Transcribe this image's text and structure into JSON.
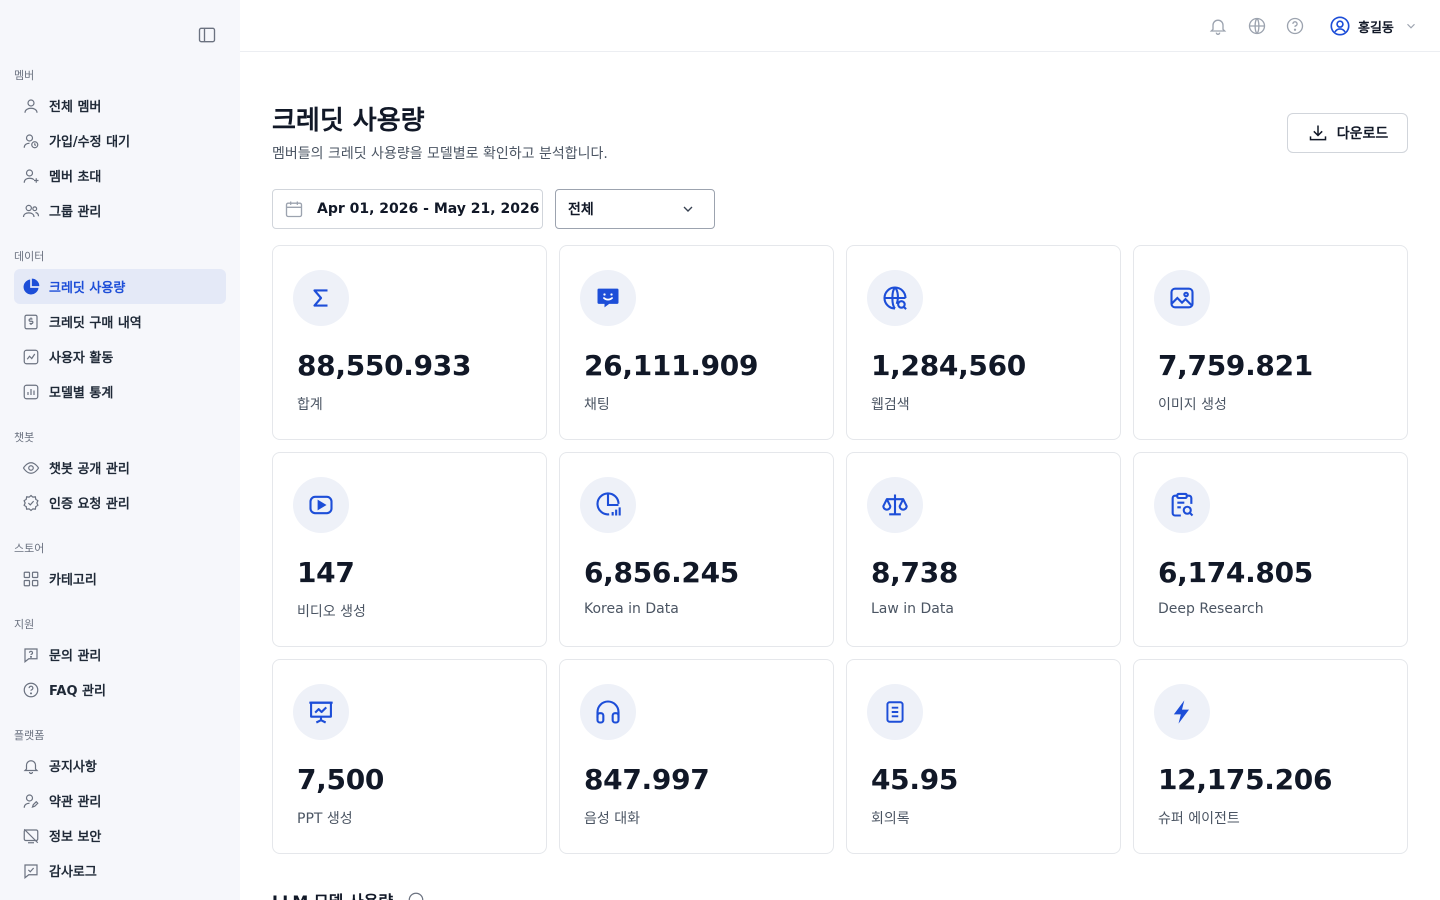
{
  "sidebar": {
    "toggle_icon": "sidebar-toggle-icon",
    "sections": [
      {
        "label": "멤버",
        "items": [
          {
            "label": "전체 멤버",
            "icon": "user-icon"
          },
          {
            "label": "가입/수정 대기",
            "icon": "user-clock-icon"
          },
          {
            "label": "멤버 초대",
            "icon": "user-plus-icon"
          },
          {
            "label": "그룹 관리",
            "icon": "users-icon"
          }
        ]
      },
      {
        "label": "데이터",
        "items": [
          {
            "label": "크레딧 사용량",
            "icon": "pie-chart-icon",
            "active": true
          },
          {
            "label": "크레딧 구매 내역",
            "icon": "receipt-dollar-icon"
          },
          {
            "label": "사용자 활동",
            "icon": "activity-chart-icon"
          },
          {
            "label": "모델별 통계",
            "icon": "bar-chart-icon"
          }
        ]
      },
      {
        "label": "챗봇",
        "items": [
          {
            "label": "챗봇 공개 관리",
            "icon": "eye-icon"
          },
          {
            "label": "인증 요청 관리",
            "icon": "badge-check-icon"
          }
        ]
      },
      {
        "label": "스토어",
        "items": [
          {
            "label": "카테고리",
            "icon": "grid-icon"
          }
        ]
      },
      {
        "label": "지원",
        "items": [
          {
            "label": "문의 관리",
            "icon": "message-question-icon"
          },
          {
            "label": "FAQ 관리",
            "icon": "help-circle-icon"
          }
        ]
      },
      {
        "label": "플랫폼",
        "items": [
          {
            "label": "공지사항",
            "icon": "bell-icon"
          },
          {
            "label": "약관 관리",
            "icon": "user-edit-icon"
          },
          {
            "label": "정보 보안",
            "icon": "shield-off-icon"
          },
          {
            "label": "감사로그",
            "icon": "message-check-icon"
          }
        ]
      }
    ]
  },
  "header": {
    "icons": [
      "bell-icon",
      "globe-icon",
      "help-icon"
    ],
    "user_name": "홍길동",
    "user_icon": "user-circle-icon"
  },
  "main": {
    "title": "크레딧 사용량",
    "subtitle": "멤버들의 크레딧 사용량을 모델별로 확인하고 분석합니다.",
    "download_label": "다운로드",
    "date_range": "Apr 01, 2026 - May 21, 2026",
    "filter_value": "전체",
    "cards": [
      {
        "value": "88,550.933",
        "label": "합계",
        "icon": "sigma-icon"
      },
      {
        "value": "26,111.909",
        "label": "채팅",
        "icon": "chat-smile-icon"
      },
      {
        "value": "1,284,560",
        "label": "웹검색",
        "icon": "globe-search-icon"
      },
      {
        "value": "7,759.821",
        "label": "이미지 생성",
        "icon": "image-icon"
      },
      {
        "value": "147",
        "label": "비디오 생성",
        "icon": "video-play-icon"
      },
      {
        "value": "6,856.245",
        "label": "Korea in Data",
        "icon": "chart-pie-bars-icon"
      },
      {
        "value": "8,738",
        "label": "Law in Data",
        "icon": "scale-icon"
      },
      {
        "value": "6,174.805",
        "label": "Deep Research",
        "icon": "clipboard-search-icon"
      },
      {
        "value": "7,500",
        "label": "PPT 생성",
        "icon": "presentation-icon"
      },
      {
        "value": "847.997",
        "label": "음성 대화",
        "icon": "headphones-icon"
      },
      {
        "value": "45.95",
        "label": "회의록",
        "icon": "document-icon"
      },
      {
        "value": "12,175.206",
        "label": "슈퍼 에이전트",
        "icon": "lightning-icon"
      }
    ],
    "bottom_heading": "LLM 모델 사용량"
  },
  "colors": {
    "accent": "#1d4ed8",
    "sidebar_bg": "#f6f7fb",
    "active_bg": "#e4e9f7"
  }
}
